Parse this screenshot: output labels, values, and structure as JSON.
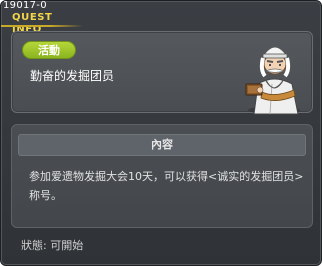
{
  "window": {
    "quest_id": "19017-0",
    "title": "QUEST INFO"
  },
  "quest": {
    "badge_label": "活動",
    "name": "勤奋的发掘团员",
    "content_header": "內容",
    "content_text": "参加爱遗物发掘大会10天，可以获得<诚实的发掘团员>称号。",
    "status_label": "狀態:",
    "status_value": "可開始"
  },
  "colors": {
    "title": "#f3d54a",
    "badge": "#9dc42a",
    "background": "#3b3f44"
  },
  "icons": [
    "close-icon",
    "npc-portrait"
  ]
}
